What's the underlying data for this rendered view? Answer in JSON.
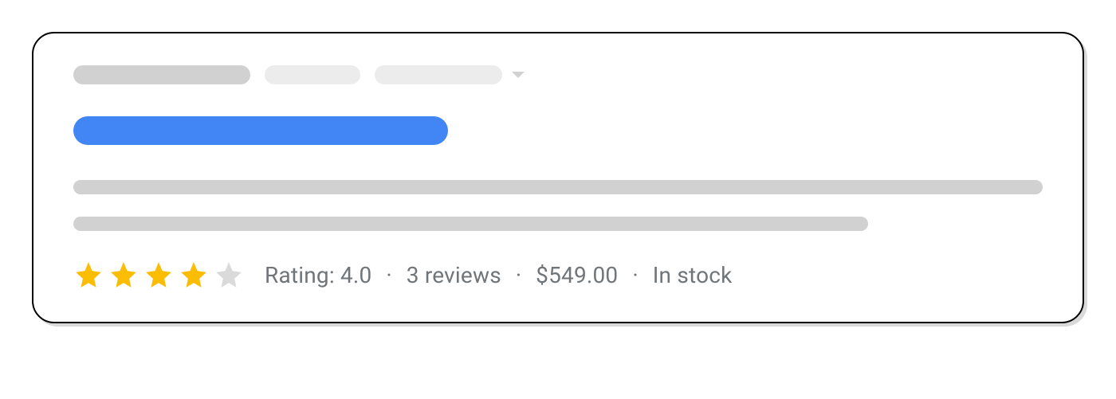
{
  "rating": {
    "label": "Rating: 4.0",
    "reviews": "3 reviews",
    "price": "$549.00",
    "stock": "In stock",
    "stars_filled": 4,
    "stars_total": 5
  },
  "separator": "·"
}
